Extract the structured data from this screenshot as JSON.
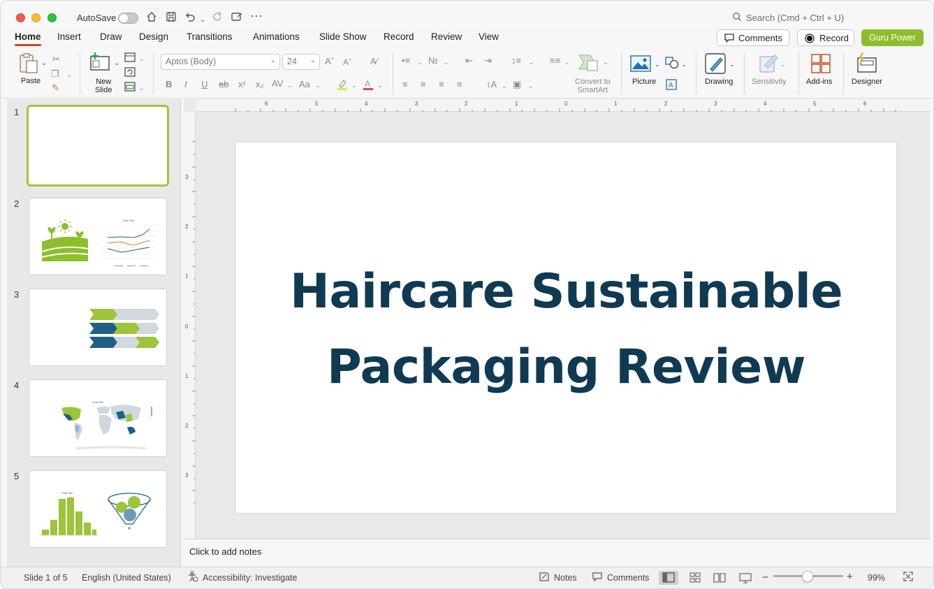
{
  "titlebar": {
    "autosave_label": "AutoSave",
    "search_placeholder": "Search (Cmd + Ctrl + U)"
  },
  "menu": {
    "tabs": [
      "Home",
      "Insert",
      "Draw",
      "Design",
      "Transitions",
      "Animations",
      "Slide Show",
      "Record",
      "Review",
      "View"
    ],
    "active_tab": "Home",
    "comments_button": "Comments",
    "record_button": "Record",
    "guru_button": "Guru Power"
  },
  "ribbon": {
    "paste": "Paste",
    "new_slide_line1": "New",
    "new_slide_line2": "Slide",
    "font_name": "Aptos (Body)",
    "font_size": "24",
    "convert_line1": "Convert to",
    "convert_line2": "SmartArt",
    "picture": "Picture",
    "drawing": "Drawing",
    "sensitivity": "Sensitivity",
    "addins": "Add-ins",
    "designer": "Designer"
  },
  "slides_panel": {
    "numbers": [
      "1",
      "2",
      "3",
      "4",
      "5"
    ],
    "thumb2_chart_title": "Chart Title",
    "thumb4_chart_title": "Chart Title",
    "thumb5_chart_title": "Chart Title",
    "selected_index": 1
  },
  "ruler": {
    "top_labels": [
      "6",
      "5",
      "4",
      "3",
      "2",
      "1",
      "0",
      "1",
      "2",
      "3",
      "4",
      "5",
      "6"
    ],
    "left_labels": [
      "3",
      "2",
      "1",
      "0",
      "1",
      "2",
      "3"
    ]
  },
  "slide": {
    "title_line1": "Haircare Sustainable",
    "title_line2": "Packaging Review"
  },
  "notes": {
    "placeholder": "Click to add notes"
  },
  "statusbar": {
    "slide_counter": "Slide 1 of 5",
    "language": "English (United States)",
    "accessibility": "Accessibility: Investigate",
    "notes": "Notes",
    "comments": "Comments",
    "zoom": "99%"
  },
  "colors": {
    "accent_green": "#8cbf2b",
    "slide_title": "#0f3a52",
    "tab_underline": "#c34a24",
    "thumb_green": "#a9c13a",
    "thumb_blue": "#1f5f86"
  }
}
